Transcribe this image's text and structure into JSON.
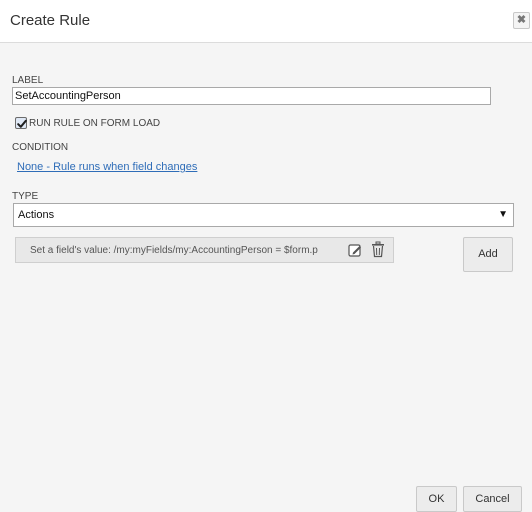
{
  "dialog": {
    "title": "Create Rule",
    "close_symbol": "✖"
  },
  "label_field": {
    "label": "LABEL",
    "value": "SetAccountingPerson"
  },
  "run_on_load": {
    "checked": true,
    "label": "RUN RULE ON FORM LOAD"
  },
  "condition": {
    "label": "CONDITION",
    "link_text": "None - Rule runs when field changes"
  },
  "type_field": {
    "label": "TYPE",
    "selected": "Actions"
  },
  "actions": [
    {
      "text": "Set a field's value: /my:myFields/my:AccountingPerson = $form.p"
    }
  ],
  "buttons": {
    "add": "Add",
    "ok": "OK",
    "cancel": "Cancel"
  },
  "icons": {
    "close": "close-icon",
    "checkbox": "checkmark-icon",
    "dropdown": "chevron-down-icon",
    "edit": "edit-icon",
    "delete": "trash-icon"
  },
  "colors": {
    "link": "#2f6db8",
    "background": "#f5f5f5",
    "action_background": "#e8e8e8"
  }
}
